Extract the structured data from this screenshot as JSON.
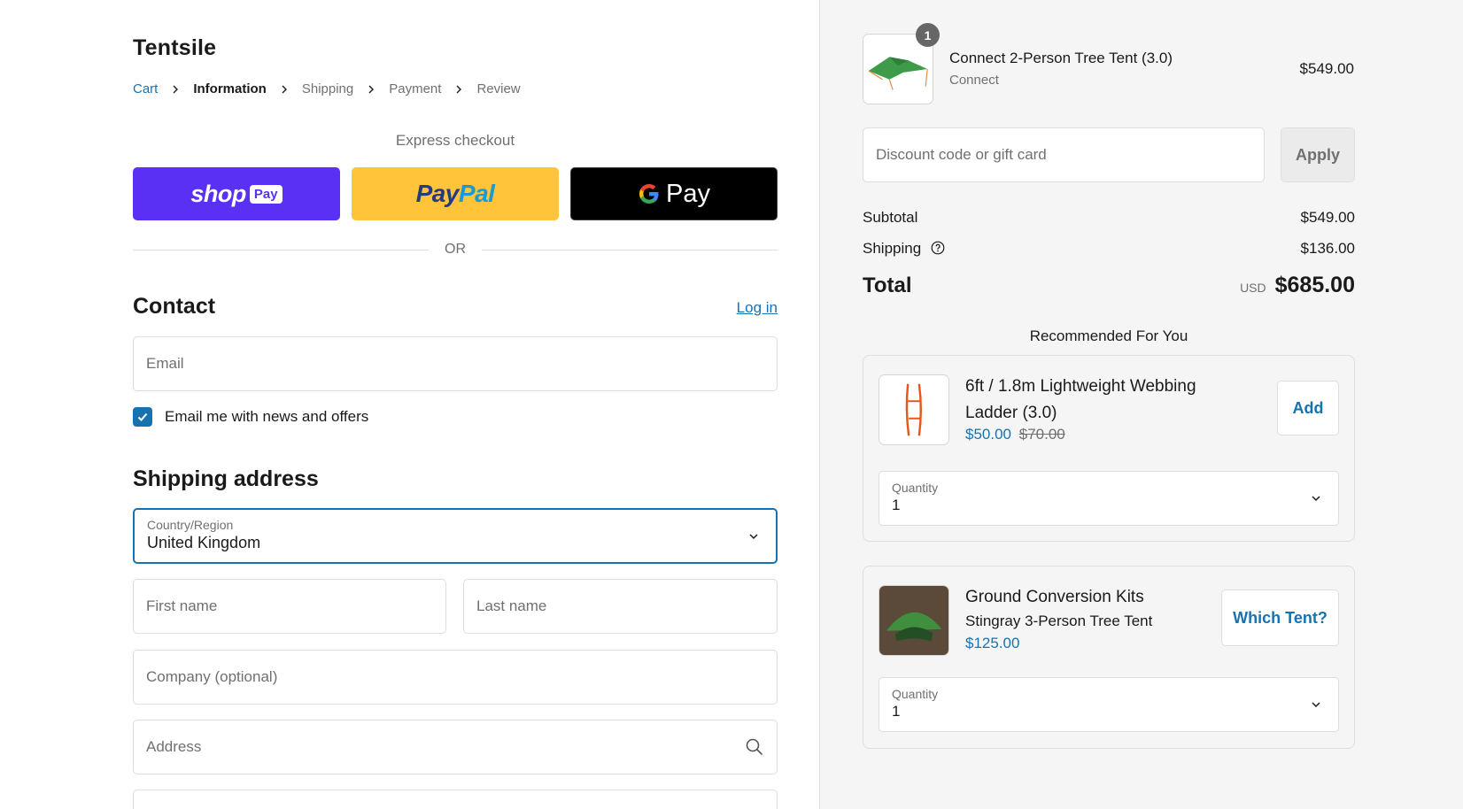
{
  "store": {
    "name": "Tentsile"
  },
  "breadcrumb": [
    {
      "label": "Cart"
    },
    {
      "label": "Information"
    },
    {
      "label": "Shipping"
    },
    {
      "label": "Payment"
    },
    {
      "label": "Review"
    }
  ],
  "express": {
    "title": "Express checkout",
    "shop_pay": {
      "word": "shop",
      "badge": "Pay"
    },
    "paypal": {
      "part1": "Pay",
      "part2": "Pal"
    },
    "gpay": {
      "word": "Pay"
    },
    "or_text": "OR"
  },
  "contact": {
    "title": "Contact",
    "login_label": "Log in",
    "email_placeholder": "Email",
    "newsletter_label": "Email me with news and offers",
    "newsletter_checked": true
  },
  "shipping_address": {
    "title": "Shipping address",
    "country_label": "Country/Region",
    "country_value": "United Kingdom",
    "first_name_placeholder": "First name",
    "last_name_placeholder": "Last name",
    "company_placeholder": "Company (optional)",
    "address_placeholder": "Address"
  },
  "order_summary": {
    "item": {
      "name": "Connect 2-Person Tree Tent (3.0)",
      "variant": "Connect",
      "price": "$549.00",
      "quantity": "1"
    },
    "discount_placeholder": "Discount code or gift card",
    "apply_label": "Apply",
    "subtotal_label": "Subtotal",
    "subtotal_value": "$549.00",
    "shipping_label": "Shipping",
    "shipping_value": "$136.00",
    "total_label": "Total",
    "currency": "USD",
    "total_value": "$685.00"
  },
  "recommendations": {
    "title": "Recommended For You",
    "items": [
      {
        "name": "6ft / 1.8m Lightweight Webbing Ladder (3.0)",
        "price": "$50.00",
        "compare_price": "$70.00",
        "button_label": "Add",
        "quantity_label": "Quantity",
        "quantity_value": "1"
      },
      {
        "name": "Ground Conversion Kits",
        "subtitle": "Stingray 3-Person Tree Tent",
        "price": "$125.00",
        "button_label": "Which Tent?",
        "quantity_label": "Quantity",
        "quantity_value": "1"
      }
    ]
  },
  "colors": {
    "link": "#1773b0",
    "shop_pay": "#5a31f4",
    "paypal": "#ffc439",
    "gpay": "#000000",
    "summary_bg": "#f5f5f5"
  }
}
